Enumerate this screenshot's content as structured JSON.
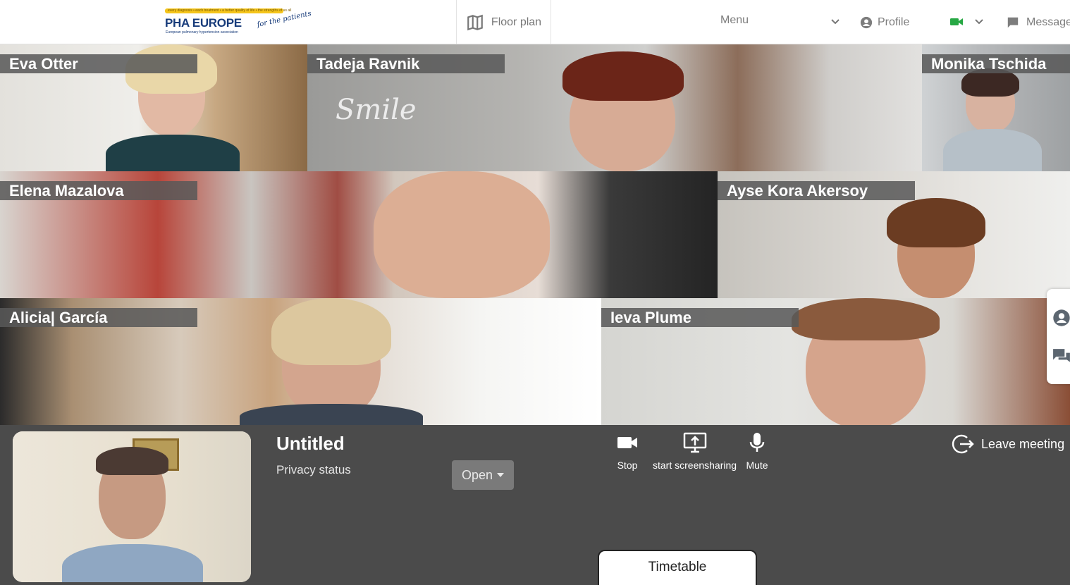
{
  "header": {
    "logo_text": "PHA EUROPE",
    "logo_strip": "every diagnosis • each treatment • a better quality of life • the strengths of us all",
    "logo_tagline": "European pulmonary hypertension association",
    "logo_script": "for the patients",
    "floor_plan_label": "Floor plan",
    "menu_label": "Menu",
    "profile_label": "Profile",
    "messages_label": "Message",
    "camera_status_color": "#27a844"
  },
  "participants": [
    {
      "name": "Eva Otter"
    },
    {
      "name": "Tadeja Ravnik"
    },
    {
      "name": "Monika Tschida"
    },
    {
      "name": "Elena Mazalova"
    },
    {
      "name": "Ayse Kora Akersoy"
    },
    {
      "name": "Alicia| García"
    },
    {
      "name": "Ieva Plume"
    }
  ],
  "meeting": {
    "title": "Untitled",
    "privacy_label": "Privacy status",
    "privacy_value": "Open"
  },
  "controls": {
    "stop_label": "Stop",
    "screenshare_label": "start screensharing",
    "mute_label": "Mute",
    "leave_label": "Leave meeting"
  },
  "timetable_label": "Timetable",
  "icons": [
    "map-icon",
    "chevron-down-icon",
    "user-circle-icon",
    "video-camera-icon",
    "chat-icon",
    "screen-share-icon",
    "microphone-icon",
    "leave-icon",
    "caret-down-icon"
  ]
}
